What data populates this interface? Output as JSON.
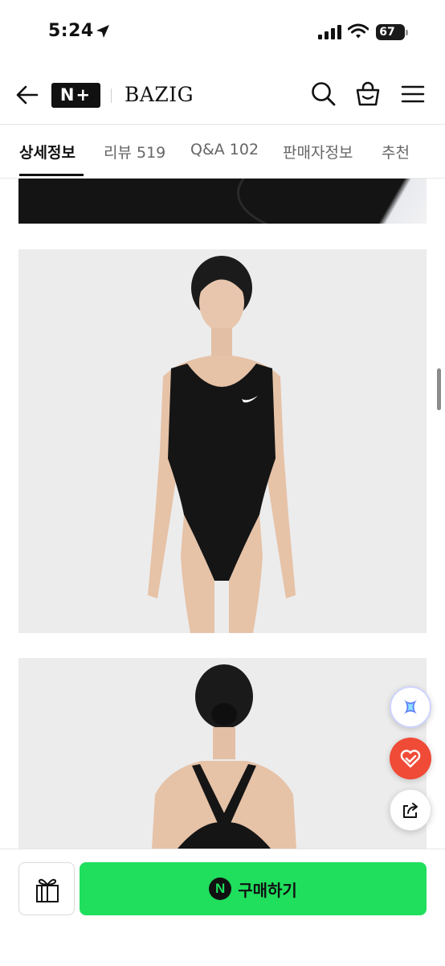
{
  "status_bar": {
    "time": "5:24",
    "battery": "67"
  },
  "header": {
    "logo": "N+",
    "brand": "BAZIG"
  },
  "tabs": [
    {
      "label": "상세정보",
      "active": true
    },
    {
      "label": "리뷰 519",
      "active": false
    },
    {
      "label": "Q&A 102",
      "active": false
    },
    {
      "label": "판매자정보",
      "active": false
    },
    {
      "label": "추천",
      "active": false
    }
  ],
  "floating": {
    "heart_color": "#f04b37"
  },
  "bottom_bar": {
    "buy_badge": "N",
    "buy_label": "구매하기",
    "buy_color": "#1fdf5d"
  }
}
